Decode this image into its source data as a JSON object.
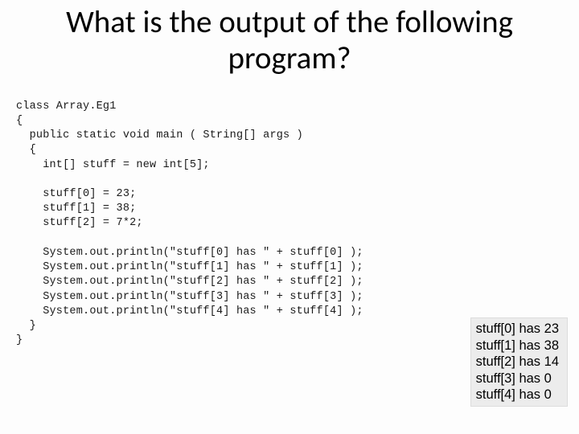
{
  "title": "What is the output of the following program?",
  "code": "class Array.Eg1\n{\n  public static void main ( String[] args )\n  {\n    int[] stuff = new int[5];\n\n    stuff[0] = 23;\n    stuff[1] = 38;\n    stuff[2] = 7*2;\n\n    System.out.println(\"stuff[0] has \" + stuff[0] );\n    System.out.println(\"stuff[1] has \" + stuff[1] );\n    System.out.println(\"stuff[2] has \" + stuff[2] );\n    System.out.println(\"stuff[3] has \" + stuff[3] );\n    System.out.println(\"stuff[4] has \" + stuff[4] );\n  }\n}",
  "output": "stuff[0] has 23\nstuff[1] has 38\nstuff[2] has 14\nstuff[3] has 0\nstuff[4] has 0"
}
